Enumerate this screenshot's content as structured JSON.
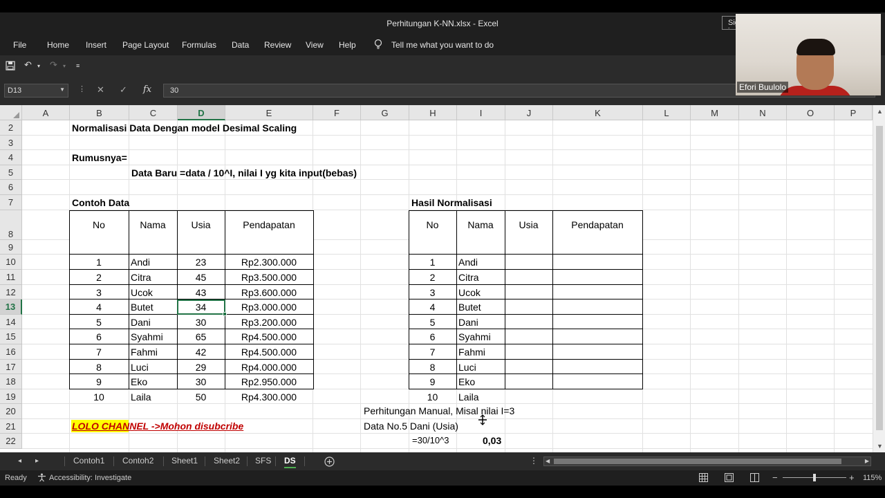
{
  "window": {
    "title": "Perhitungan K-NN.xlsx  -  Excel",
    "signin_label": "Sign in"
  },
  "ribbon": {
    "tabs": [
      "File",
      "Home",
      "Insert",
      "Page Layout",
      "Formulas",
      "Data",
      "Review",
      "View",
      "Help"
    ],
    "tell_me": "Tell me what you want to do"
  },
  "formula_bar": {
    "name_box": "D13",
    "formula": "30",
    "fx_label": "fx"
  },
  "columns": [
    "A",
    "B",
    "C",
    "D",
    "E",
    "F",
    "G",
    "H",
    "I",
    "J",
    "K",
    "L",
    "M",
    "N",
    "O",
    "P"
  ],
  "selected_column": "D",
  "rows": [
    "2",
    "3",
    "4",
    "5",
    "6",
    "7",
    "8",
    "9",
    "10",
    "11",
    "12",
    "13",
    "14",
    "15",
    "16",
    "17",
    "18",
    "19",
    "20",
    "21",
    "22"
  ],
  "selected_row": "13",
  "sheet": {
    "title": "Normalisasi Data Dengan model Desimal Scaling",
    "rumus_label": "Rumusnya=",
    "rumus": "Data Baru =data / 10^I, nilai I yg kita input(bebas)",
    "contoh_label": "Contoh Data",
    "hasil_label": "Hasil Normalisasi",
    "table1_headers": [
      "No",
      "Nama",
      "Usia",
      "Pendapatan"
    ],
    "table1_rows": [
      [
        "1",
        "Andi",
        "23",
        "Rp2.300.000"
      ],
      [
        "2",
        "Citra",
        "45",
        "Rp3.500.000"
      ],
      [
        "3",
        "Ucok",
        "43",
        "Rp3.600.000"
      ],
      [
        "4",
        "Butet",
        "34",
        "Rp3.000.000"
      ],
      [
        "5",
        "Dani",
        "30",
        "Rp3.200.000"
      ],
      [
        "6",
        "Syahmi",
        "65",
        "Rp4.500.000"
      ],
      [
        "7",
        "Fahmi",
        "42",
        "Rp4.500.000"
      ],
      [
        "8",
        "Luci",
        "29",
        "Rp4.000.000"
      ],
      [
        "9",
        "Eko",
        "30",
        "Rp2.950.000"
      ],
      [
        "10",
        "Laila",
        "50",
        "Rp4.300.000"
      ]
    ],
    "table2_headers": [
      "No",
      "Nama",
      "Usia",
      "Pendapatan"
    ],
    "table2_rows": [
      [
        "1",
        "Andi"
      ],
      [
        "2",
        "Citra"
      ],
      [
        "3",
        "Ucok"
      ],
      [
        "4",
        "Butet"
      ],
      [
        "5",
        "Dani"
      ],
      [
        "6",
        "Syahmi"
      ],
      [
        "7",
        "Fahmi"
      ],
      [
        "8",
        "Luci"
      ],
      [
        "9",
        "Eko"
      ],
      [
        "10",
        "Laila"
      ]
    ],
    "manual_label": "Perhitungan Manual, Misal nilai I=3",
    "manual_data": "Data No.5 Dani (Usia)",
    "manual_formula": "=30/10^3",
    "manual_result": "0,03",
    "channel_promo": "LOLO CHANNEL ->Mohon disubcribe"
  },
  "sheet_tabs": [
    "Contoh1",
    "Contoh2",
    "Sheet1",
    "Sheet2",
    "SFS",
    "DS"
  ],
  "active_sheet": "DS",
  "status": {
    "ready": "Ready",
    "accessibility": "Accessibility: Investigate",
    "zoom": "115%"
  },
  "webcam": {
    "name": "Efori Buulolo"
  },
  "colors": {
    "excel_green": "#217346",
    "promo_text": "#c00000",
    "promo_highlight": "#ffff00"
  }
}
